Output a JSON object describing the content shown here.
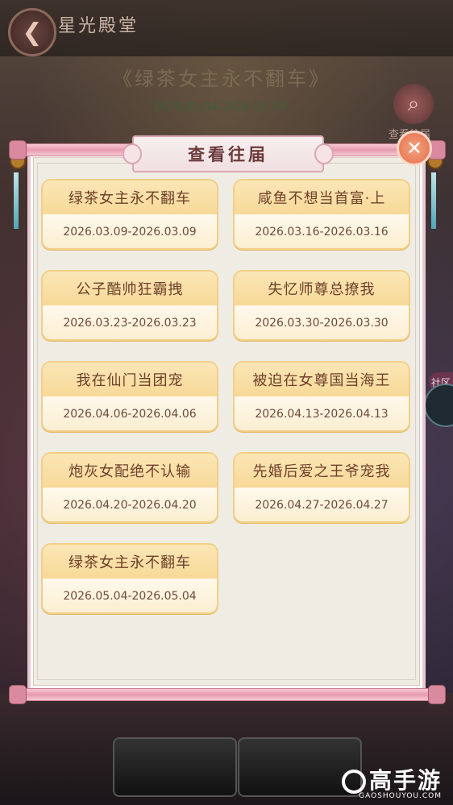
{
  "top": {
    "hall_title": "星光殿堂",
    "event_title": "《绿茶女主永不翻车》",
    "event_date": "2026.05.04-2026.05.04",
    "view_past_label": "查看往届"
  },
  "dialog": {
    "title": "查看往届",
    "close_icon": "close-icon",
    "items": [
      {
        "name": "绿茶女主永不翻车",
        "date": "2026.03.09-2026.03.09"
      },
      {
        "name": "咸鱼不想当首富·上",
        "date": "2026.03.16-2026.03.16"
      },
      {
        "name": "公子酷帅狂霸拽",
        "date": "2026.03.23-2026.03.23"
      },
      {
        "name": "失忆师尊总撩我",
        "date": "2026.03.30-2026.03.30"
      },
      {
        "name": "我在仙门当团宠",
        "date": "2026.04.06-2026.04.06"
      },
      {
        "name": "被迫在女尊国当海王",
        "date": "2026.04.13-2026.04.13"
      },
      {
        "name": "炮灰女配绝不认输",
        "date": "2026.04.20-2026.04.20"
      },
      {
        "name": "先婚后爱之王爷宠我",
        "date": "2026.04.27-2026.04.27"
      },
      {
        "name": "绿茶女主永不翻车",
        "date": "2026.05.04-2026.05.04"
      }
    ]
  },
  "side": {
    "community_label": "社区"
  },
  "watermark": {
    "logo": "高手游",
    "site": "GAOSHOUYOU.COM"
  },
  "colors": {
    "card_header": "#f7d998",
    "card_border": "#f1cf86",
    "panel": "#efece4",
    "rod": "#e89aae",
    "close": "#e56f4c"
  }
}
